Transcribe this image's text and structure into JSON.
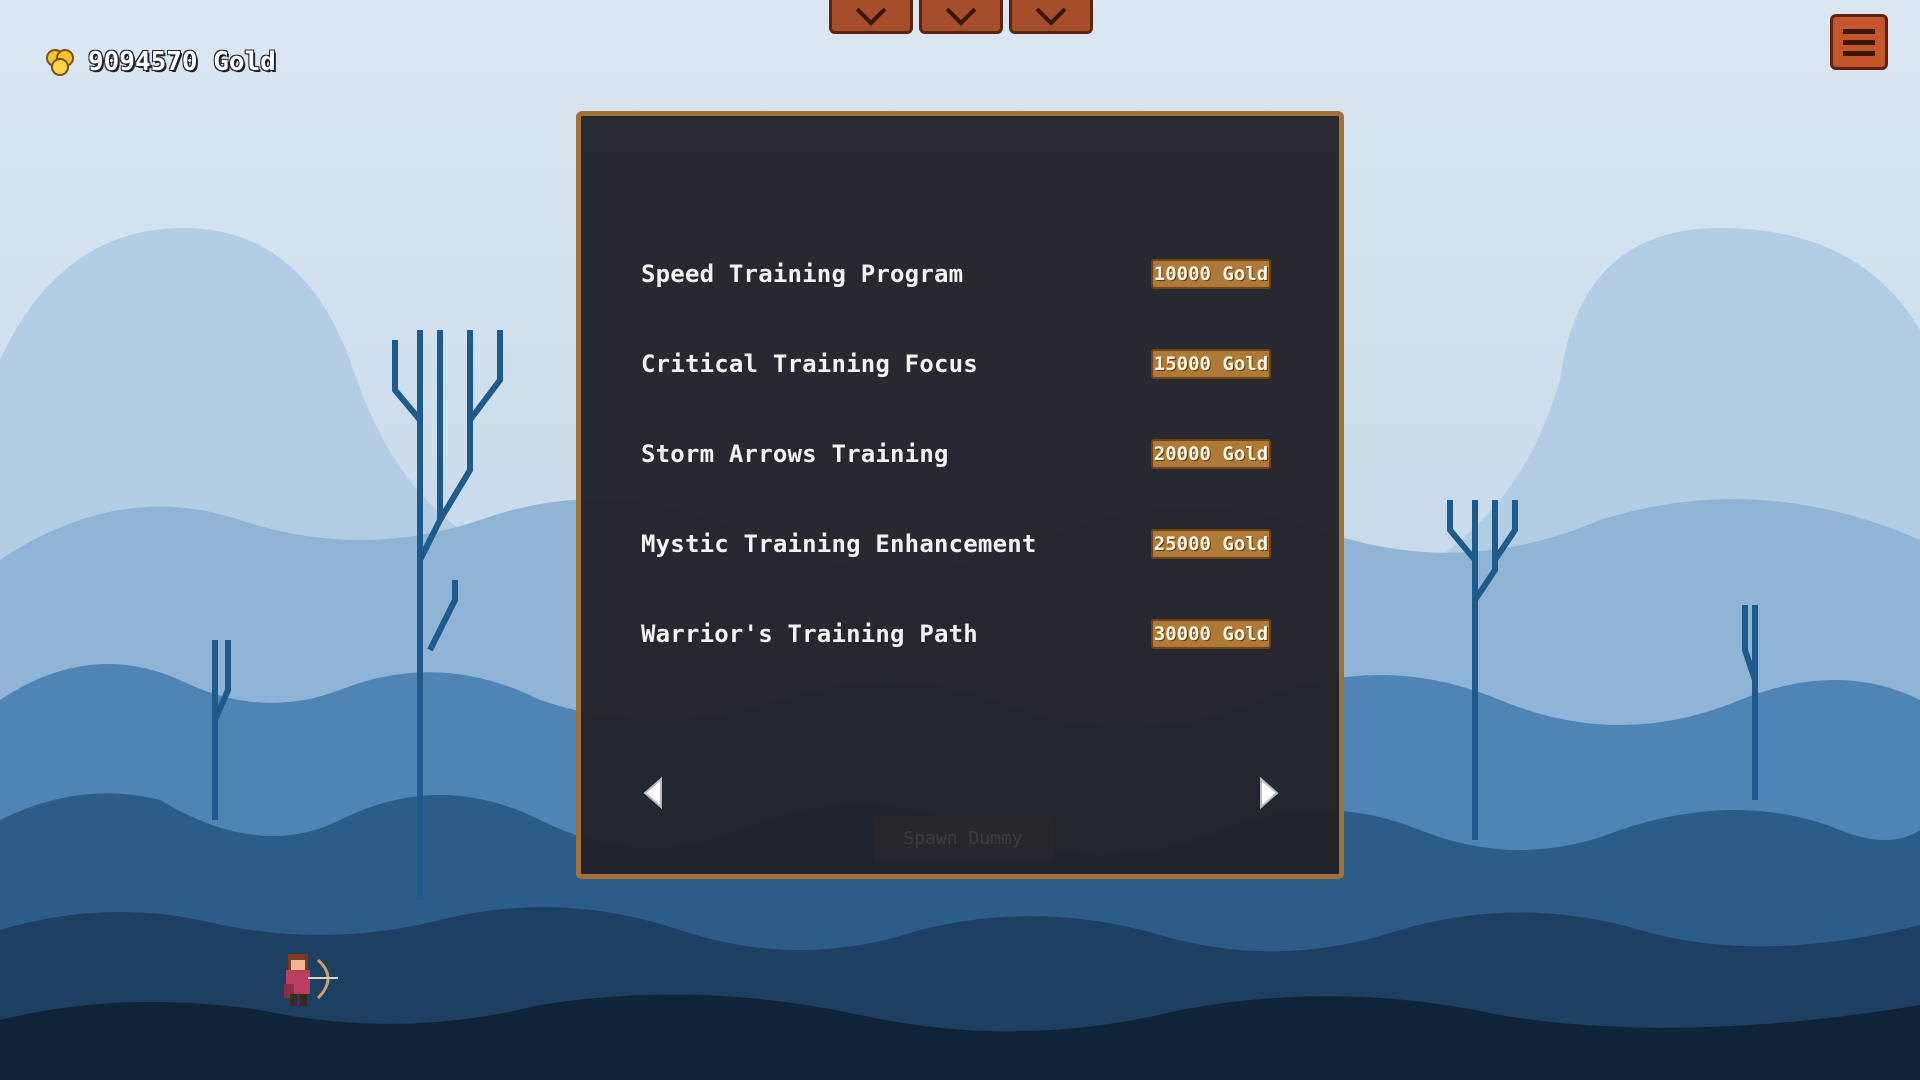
{
  "hud": {
    "gold_label": "9094570 Gold",
    "coin_icon": "gold-coins-icon",
    "lives": [
      {
        "icon": "heart-icon"
      },
      {
        "icon": "heart-icon"
      },
      {
        "icon": "heart-icon"
      }
    ],
    "menu_icon": "hamburger-menu-icon"
  },
  "panel": {
    "items": [
      {
        "name": "Speed Training Program",
        "price": "10000 Gold"
      },
      {
        "name": "Critical Training Focus",
        "price": "15000 Gold"
      },
      {
        "name": "Storm Arrows Training",
        "price": "20000 Gold"
      },
      {
        "name": "Mystic Training Enhancement",
        "price": "25000 Gold"
      },
      {
        "name": "Warrior's Training Path",
        "price": "30000 Gold"
      }
    ],
    "prev_icon": "arrow-left-icon",
    "next_icon": "arrow-right-icon"
  },
  "spawn_button": {
    "label": "Spawn Dummy"
  },
  "colors": {
    "panel_bg": "#22222a",
    "panel_border": "#a47238",
    "price_button": "#b07a36",
    "hud_button": "#c4562a",
    "sky": "#d9e6f1"
  }
}
